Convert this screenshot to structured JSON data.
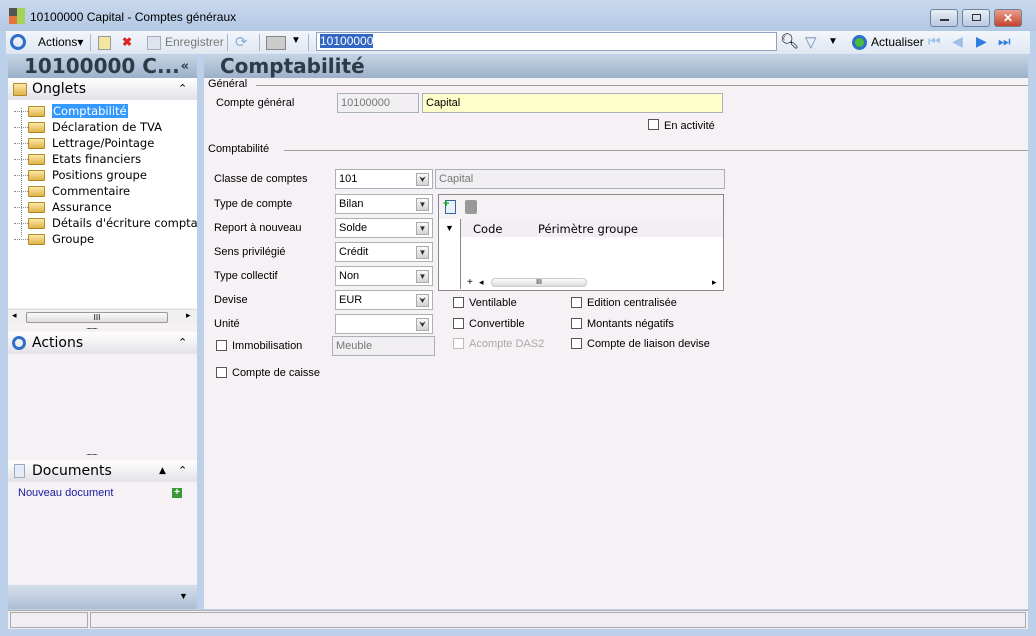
{
  "window": {
    "title": "10100000 Capital -  Comptes généraux"
  },
  "toolbar": {
    "actions": "Actions",
    "save": "Enregistrer",
    "search_value": "10100000",
    "refresh": "Actualiser"
  },
  "left": {
    "header": "10100000 C...",
    "onglets": "Onglets",
    "tabs": [
      "Comptabilité",
      "Déclaration de TVA",
      "Lettrage/Pointage",
      "Etats financiers",
      "Positions groupe",
      "Commentaire",
      "Assurance",
      "Détails d'écriture comptab",
      "Groupe"
    ],
    "actions": "Actions",
    "documents": "Documents",
    "new_document": "Nouveau document"
  },
  "main": {
    "header": "Comptabilité",
    "general": {
      "legend": "Général",
      "compte_label": "Compte général",
      "compte_code": "10100000",
      "compte_name": "Capital",
      "en_activite": "En activité"
    },
    "compta": {
      "legend": "Comptabilité",
      "fields": [
        {
          "label": "Classe de comptes",
          "value": "101"
        },
        {
          "label": "Type de compte",
          "value": "Bilan"
        },
        {
          "label": "Report à nouveau",
          "value": "Solde"
        },
        {
          "label": "Sens privilégié",
          "value": "Crédit"
        },
        {
          "label": "Type collectif",
          "value": "Non"
        },
        {
          "label": "Devise",
          "value": "EUR"
        },
        {
          "label": "Unité",
          "value": ""
        }
      ],
      "classe_desc": "Capital",
      "immobilisation": "Immobilisation",
      "immobilisation_value": "Meuble",
      "compte_caisse": "Compte de caisse",
      "grid": {
        "col1": "Code",
        "col2": "Périmètre groupe"
      },
      "checks": [
        "Ventilable",
        "Edition centralisée",
        "Convertible",
        "Montants négatifs",
        "Acompte DAS2",
        "Compte de liaison devise"
      ]
    }
  }
}
